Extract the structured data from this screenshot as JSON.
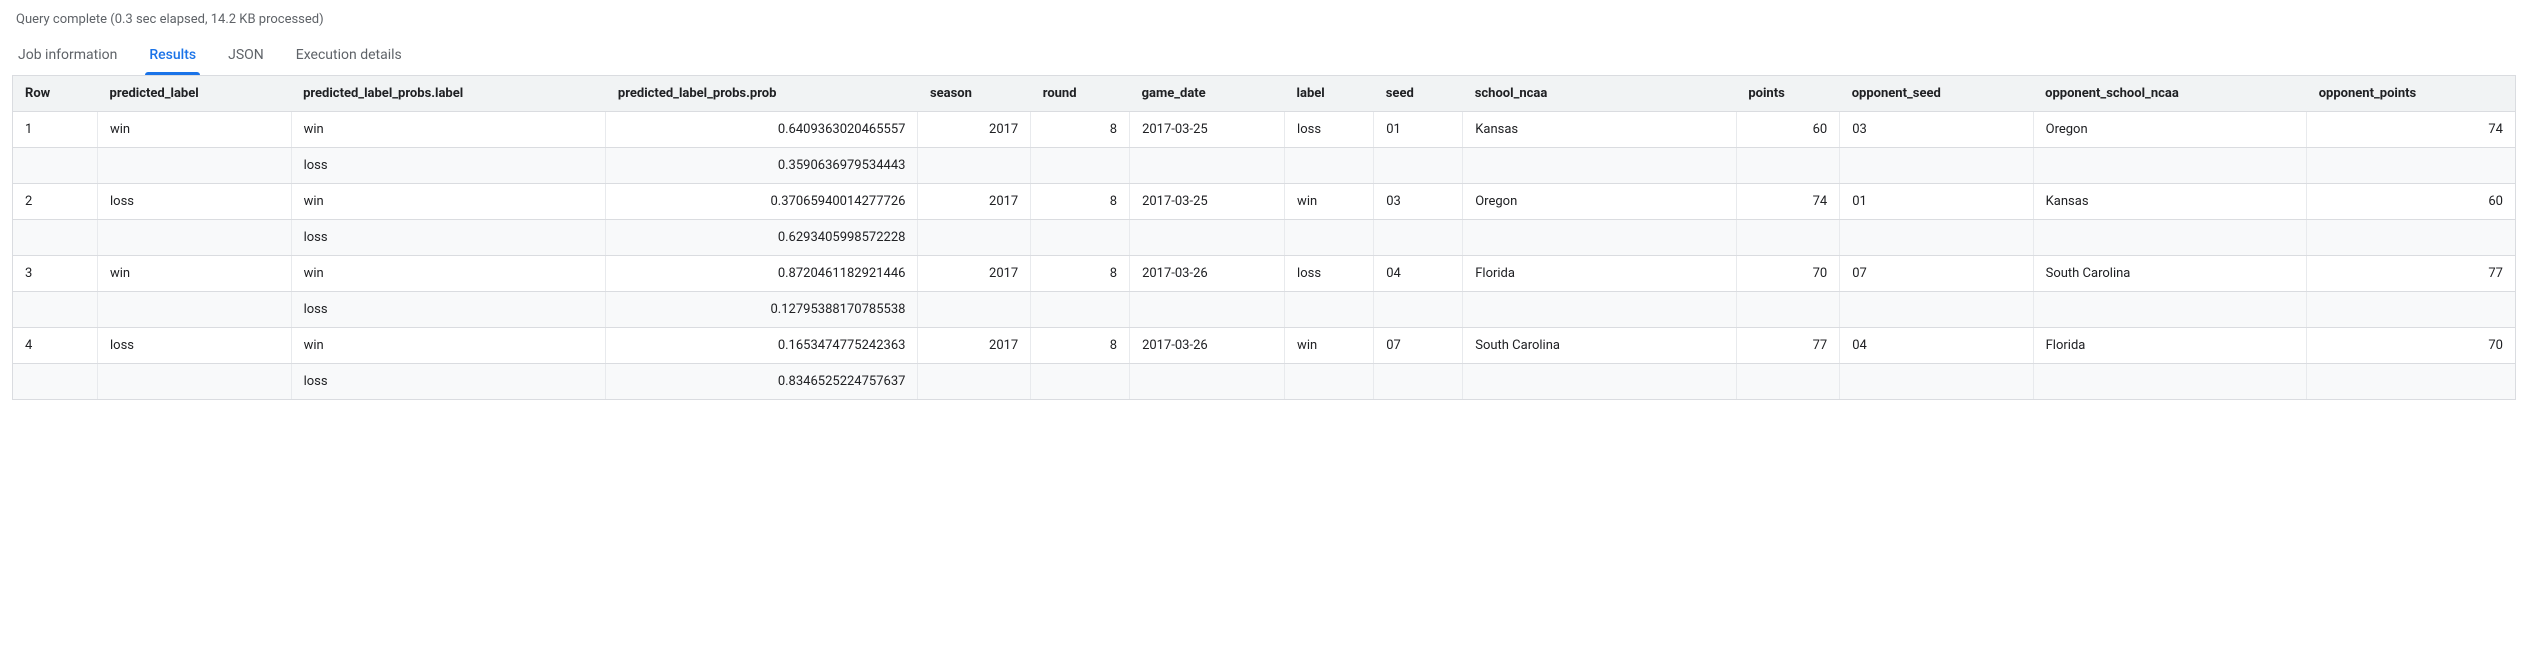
{
  "status": "Query complete (0.3 sec elapsed, 14.2 KB processed)",
  "tabs": {
    "job_info": "Job information",
    "results": "Results",
    "json": "JSON",
    "execution": "Execution details"
  },
  "columns": [
    "Row",
    "predicted_label",
    "predicted_label_probs.label",
    "predicted_label_probs.prob",
    "season",
    "round",
    "game_date",
    "label",
    "seed",
    "school_ncaa",
    "points",
    "opponent_seed",
    "opponent_school_ncaa",
    "opponent_points"
  ],
  "rows": [
    {
      "row": "1",
      "predicted_label": "win",
      "probs": [
        {
          "label": "win",
          "prob": "0.6409363020465557"
        },
        {
          "label": "loss",
          "prob": "0.3590636979534443"
        }
      ],
      "season": "2017",
      "round": "8",
      "game_date": "2017-03-25",
      "label": "loss",
      "seed": "01",
      "school_ncaa": "Kansas",
      "points": "60",
      "opponent_seed": "03",
      "opponent_school_ncaa": "Oregon",
      "opponent_points": "74"
    },
    {
      "row": "2",
      "predicted_label": "loss",
      "probs": [
        {
          "label": "win",
          "prob": "0.37065940014277726"
        },
        {
          "label": "loss",
          "prob": "0.6293405998572228"
        }
      ],
      "season": "2017",
      "round": "8",
      "game_date": "2017-03-25",
      "label": "win",
      "seed": "03",
      "school_ncaa": "Oregon",
      "points": "74",
      "opponent_seed": "01",
      "opponent_school_ncaa": "Kansas",
      "opponent_points": "60"
    },
    {
      "row": "3",
      "predicted_label": "win",
      "probs": [
        {
          "label": "win",
          "prob": "0.8720461182921446"
        },
        {
          "label": "loss",
          "prob": "0.12795388170785538"
        }
      ],
      "season": "2017",
      "round": "8",
      "game_date": "2017-03-26",
      "label": "loss",
      "seed": "04",
      "school_ncaa": "Florida",
      "points": "70",
      "opponent_seed": "07",
      "opponent_school_ncaa": "South Carolina",
      "opponent_points": "77"
    },
    {
      "row": "4",
      "predicted_label": "loss",
      "probs": [
        {
          "label": "win",
          "prob": "0.1653474775242363"
        },
        {
          "label": "loss",
          "prob": "0.8346525224757637"
        }
      ],
      "season": "2017",
      "round": "8",
      "game_date": "2017-03-26",
      "label": "win",
      "seed": "07",
      "school_ncaa": "South Carolina",
      "points": "77",
      "opponent_seed": "04",
      "opponent_school_ncaa": "Florida",
      "opponent_points": "70"
    }
  ]
}
